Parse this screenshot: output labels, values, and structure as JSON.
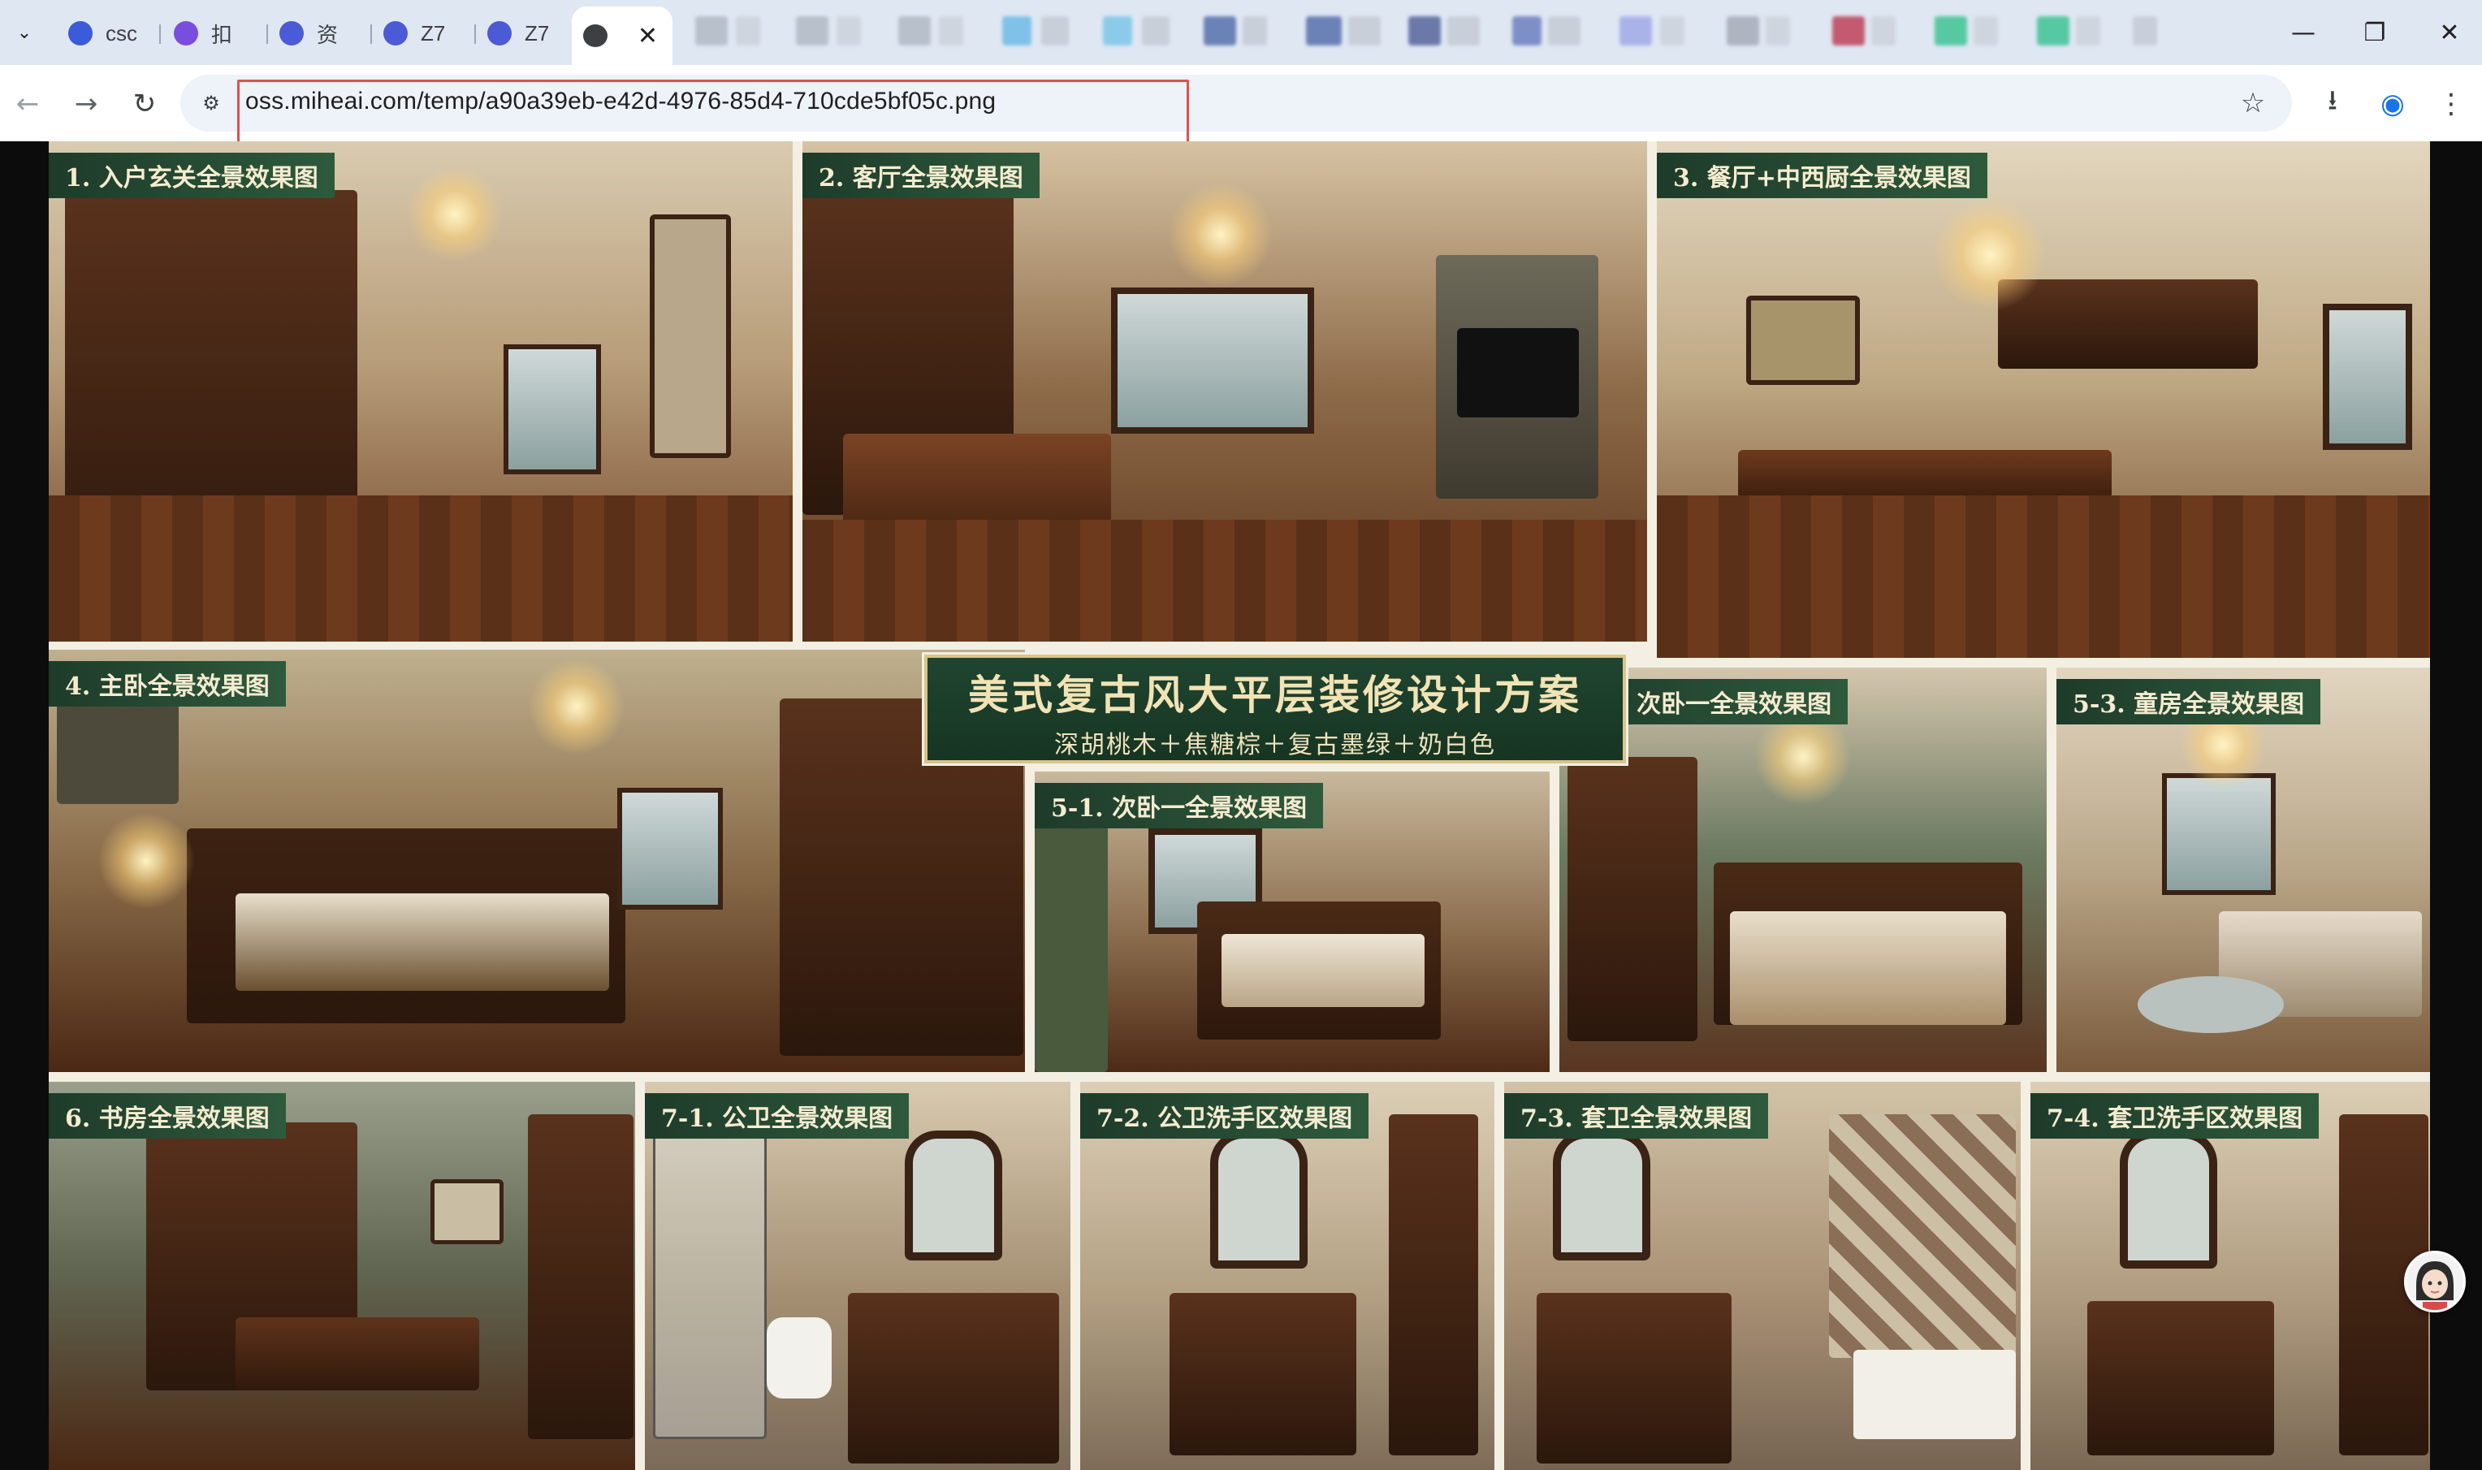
{
  "browser": {
    "tabs": [
      {
        "label": "csc",
        "favicon_color": "#3b5bdb",
        "active": false
      },
      {
        "label": "扣",
        "favicon_color": "#7b4dde",
        "active": false
      },
      {
        "label": "资",
        "favicon_color": "#4b5bd6",
        "active": false
      },
      {
        "label": "Z7",
        "favicon_color": "#4b5bd6",
        "active": false
      },
      {
        "label": "Z7",
        "favicon_color": "#4b5bd6",
        "active": false
      },
      {
        "label": "",
        "favicon_color": "#3c4043",
        "active": true
      }
    ],
    "active_tab_close": "✕",
    "tab_menu_icon": "chevron-down-icon",
    "window_controls": {
      "minimize": "—",
      "maximize": "❐",
      "close": "✕"
    },
    "toolbar": {
      "back": "←",
      "forward": "→",
      "reload": "↻",
      "site_info": "⚙",
      "url": "oss.miheai.com/temp/a90a39eb-e42d-4976-85d4-710cde5bf05c.png",
      "bookmark": "☆",
      "download": "⭳",
      "profile": "◉",
      "menu": "⋮"
    }
  },
  "poster": {
    "title": "美式复古风大平层装修设计方案",
    "subtitle": "深胡桃木＋焦糖棕＋复古墨绿＋奶白色",
    "panels": [
      {
        "label": "1. 入户玄关全景效果图"
      },
      {
        "label": "2. 客厅全景效果图"
      },
      {
        "label": "3. 餐厅+中西厨全景效果图"
      },
      {
        "label": "4. 主卧全景效果图"
      },
      {
        "label": "5-1. 次卧一全景效果图"
      },
      {
        "label": "5-1. 次卧一全景效果图"
      },
      {
        "label": "5-3. 童房全景效果图"
      },
      {
        "label": "6. 书房全景效果图"
      },
      {
        "label": "7-1. 公卫全景效果图"
      },
      {
        "label": "7-2. 公卫洗手区效果图"
      },
      {
        "label": "7-3. 套卫全景效果图"
      },
      {
        "label": "7-4. 套卫洗手区效果图"
      }
    ]
  }
}
